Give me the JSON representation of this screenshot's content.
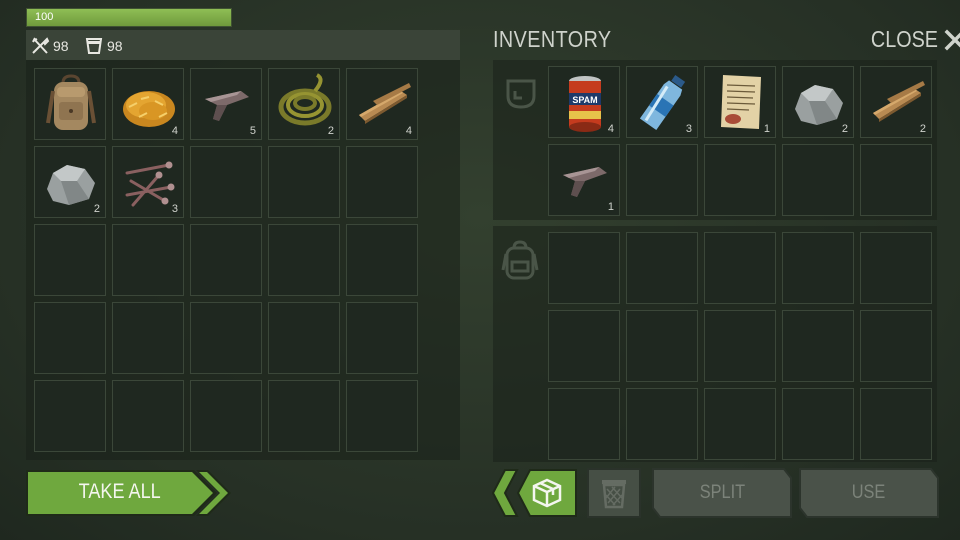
{
  "player": {
    "health": "100",
    "health_fraction": 1.0,
    "food": "98",
    "water": "98"
  },
  "header": {
    "title": "INVENTORY",
    "close_label": "CLOSE"
  },
  "left_container": {
    "items": [
      {
        "icon": "backpack-icon",
        "count": ""
      },
      {
        "icon": "dry-grass-icon",
        "count": "4"
      },
      {
        "icon": "scrap-metal-icon",
        "count": "5"
      },
      {
        "icon": "rope-icon",
        "count": "2"
      },
      {
        "icon": "wood-plank-icon",
        "count": "4"
      },
      {
        "icon": "stone-icon",
        "count": "2"
      },
      {
        "icon": "nails-icon",
        "count": "3"
      }
    ]
  },
  "right_inventory": {
    "pocket_items": [
      {
        "icon": "spam-can-icon",
        "count": "4"
      },
      {
        "icon": "water-bottle-icon",
        "count": "3"
      },
      {
        "icon": "note-icon",
        "count": "1"
      },
      {
        "icon": "stone-icon",
        "count": "2"
      },
      {
        "icon": "wood-plank-icon",
        "count": "2"
      },
      {
        "icon": "scrap-metal-icon",
        "count": "1"
      }
    ]
  },
  "buttons": {
    "take_all": "TAKE ALL",
    "split": "SPLIT",
    "use": "USE"
  },
  "colors": {
    "accent_green": "#6fa83e",
    "disabled_button": "#4a5249"
  }
}
